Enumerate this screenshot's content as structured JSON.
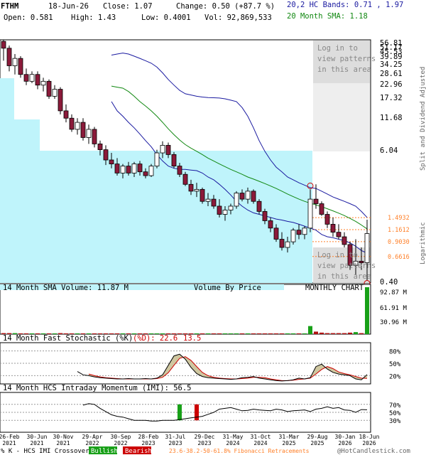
{
  "header": {
    "ticker": "FTHM",
    "date": "18-Jun-26",
    "close_label": "Close: 1.07",
    "change_label": "Change: 0.50 (+87.7 %)",
    "open_label": "Open: 0.581",
    "high_label": "High: 1.43",
    "low_label": "Low: 0.4001",
    "vol_label": "Vol: 92,869,533",
    "bands_label": "20,2 HC Bands: 0.71 , 1.97",
    "sma_label": "20 Month SMA: 1.18"
  },
  "overlay_text": {
    "login_top": [
      "Log in to",
      "view patterns",
      "in this area"
    ],
    "login_bottom": [
      "Log in to",
      "view patterns",
      "in this area"
    ]
  },
  "vertical_labels": {
    "adjusted": "Split and Dividend Adjusted",
    "scale": "Logarithmic"
  },
  "panel_titles": {
    "volume": "14 Month SMA Volume: 11.87 M",
    "volume_by_price": "Volume By Price",
    "monthly": "MONTHLY CHART",
    "stoch_main": "14 Month Fast Stochastic (%K)",
    "stoch_d": "(%D): 22.6",
    "stoch_d_val": "13.5",
    "imi": "14 Month HCS Intraday Momentum (IMI): 56.5"
  },
  "footer": {
    "prefix": "% K - HCS IMI Crossover:",
    "bullish": "Bullish",
    "bearish": "Bearish",
    "fib": "23.6-38.2-50-61.8% Fibonacci Retracements",
    "copyright": "@HotCandlestick.com"
  },
  "colors": {
    "bull": "#ffffff",
    "bear": "#8b1a3a",
    "hc_band": "#1a1aa0",
    "sma": "#118811",
    "vol_bar_bull": "#18a018",
    "vol_bar_bear": "#b01010",
    "cyan": "#bff4fb",
    "gray": "#dddddd",
    "fib": "#ff7f27",
    "stoch_fill": "#cfc7a0",
    "stoch_k": "#000000",
    "stoch_d": "#cc0000"
  },
  "chart_data": {
    "type": "candlestick",
    "scale": "log",
    "price_axis_labels": [
      "56.81",
      "51.17",
      "45.53",
      "39.89",
      "34.25",
      "28.61",
      "22.96",
      "17.32",
      "11.68",
      "6.04",
      "0.40"
    ],
    "fib_levels": [
      "1.4932",
      "1.1612",
      "0.9030",
      "0.6616"
    ],
    "x_tick_labels": [
      "26-Feb\n2021",
      "30-Jun\n2021",
      "30-Nov\n2021",
      "29-Apr\n2022",
      "30-Sep\n2022",
      "28-Feb\n2023",
      "31-Jul\n2023",
      "29-Dec\n2023",
      "31-May\n2024",
      "31-Oct\n2024",
      "31-Mar\n2025",
      "29-Aug\n2025",
      "30-Jan\n2026",
      "18-Jun\n2026"
    ],
    "volume_axis_labels": [
      "92.87 M",
      "61.91 M",
      "30.96 M"
    ],
    "stoch_axis_labels": [
      "80%",
      "50%",
      "20%"
    ],
    "imi_axis_labels": [
      "70%",
      "50%",
      "30%"
    ],
    "candles": [
      {
        "o": 60,
        "h": 62,
        "l": 40,
        "c": 52
      },
      {
        "o": 52,
        "h": 55,
        "l": 32,
        "c": 36
      },
      {
        "o": 36,
        "h": 46,
        "l": 30,
        "c": 42
      },
      {
        "o": 42,
        "h": 44,
        "l": 28,
        "c": 30
      },
      {
        "o": 30,
        "h": 34,
        "l": 24,
        "c": 26
      },
      {
        "o": 26,
        "h": 32,
        "l": 25,
        "c": 30
      },
      {
        "o": 30,
        "h": 32,
        "l": 22,
        "c": 24
      },
      {
        "o": 24,
        "h": 28,
        "l": 21,
        "c": 26
      },
      {
        "o": 26,
        "h": 27,
        "l": 18,
        "c": 19
      },
      {
        "o": 19,
        "h": 24,
        "l": 18,
        "c": 22
      },
      {
        "o": 22,
        "h": 23,
        "l": 13,
        "c": 14
      },
      {
        "o": 14,
        "h": 16,
        "l": 11,
        "c": 12
      },
      {
        "o": 12,
        "h": 13,
        "l": 9,
        "c": 9.5
      },
      {
        "o": 9.5,
        "h": 12,
        "l": 8.5,
        "c": 11
      },
      {
        "o": 11,
        "h": 12,
        "l": 7.5,
        "c": 8
      },
      {
        "o": 8,
        "h": 10.5,
        "l": 7,
        "c": 9.5
      },
      {
        "o": 9.5,
        "h": 10,
        "l": 6.5,
        "c": 7
      },
      {
        "o": 7,
        "h": 7.5,
        "l": 5.5,
        "c": 6.2
      },
      {
        "o": 6.2,
        "h": 6.8,
        "l": 4.5,
        "c": 5
      },
      {
        "o": 5,
        "h": 5.8,
        "l": 4.2,
        "c": 4.6
      },
      {
        "o": 4.6,
        "h": 5.2,
        "l": 3.6,
        "c": 3.8
      },
      {
        "o": 3.8,
        "h": 4.6,
        "l": 3.4,
        "c": 4.4
      },
      {
        "o": 4.4,
        "h": 4.8,
        "l": 3.6,
        "c": 3.8
      },
      {
        "o": 3.8,
        "h": 4.8,
        "l": 3.5,
        "c": 4.6
      },
      {
        "o": 4.6,
        "h": 4.9,
        "l": 3.6,
        "c": 3.9
      },
      {
        "o": 3.9,
        "h": 4.2,
        "l": 3.4,
        "c": 3.6
      },
      {
        "o": 3.6,
        "h": 4.6,
        "l": 3.5,
        "c": 4.4
      },
      {
        "o": 4.4,
        "h": 6.2,
        "l": 4.2,
        "c": 5.8
      },
      {
        "o": 5.8,
        "h": 7.4,
        "l": 5.2,
        "c": 6.8
      },
      {
        "o": 6.8,
        "h": 7.2,
        "l": 5.2,
        "c": 5.6
      },
      {
        "o": 5.6,
        "h": 5.9,
        "l": 4.2,
        "c": 4.4
      },
      {
        "o": 4.4,
        "h": 4.7,
        "l": 3.5,
        "c": 3.7
      },
      {
        "o": 3.7,
        "h": 3.9,
        "l": 2.9,
        "c": 3.0
      },
      {
        "o": 3.0,
        "h": 3.3,
        "l": 2.4,
        "c": 2.6
      },
      {
        "o": 2.6,
        "h": 3.1,
        "l": 2.3,
        "c": 2.7
      },
      {
        "o": 2.7,
        "h": 2.8,
        "l": 2.0,
        "c": 2.1
      },
      {
        "o": 2.1,
        "h": 2.5,
        "l": 1.9,
        "c": 2.2
      },
      {
        "o": 2.2,
        "h": 2.4,
        "l": 1.8,
        "c": 1.9
      },
      {
        "o": 1.9,
        "h": 2.2,
        "l": 1.5,
        "c": 1.6
      },
      {
        "o": 1.6,
        "h": 1.9,
        "l": 1.4,
        "c": 1.75
      },
      {
        "o": 1.75,
        "h": 2.0,
        "l": 1.6,
        "c": 1.9
      },
      {
        "o": 1.9,
        "h": 2.6,
        "l": 1.8,
        "c": 2.5
      },
      {
        "o": 2.5,
        "h": 2.7,
        "l": 2.1,
        "c": 2.2
      },
      {
        "o": 2.2,
        "h": 2.8,
        "l": 2.0,
        "c": 2.6
      },
      {
        "o": 2.6,
        "h": 2.7,
        "l": 2.0,
        "c": 2.1
      },
      {
        "o": 2.1,
        "h": 2.2,
        "l": 1.6,
        "c": 1.7
      },
      {
        "o": 1.7,
        "h": 1.8,
        "l": 1.3,
        "c": 1.4
      },
      {
        "o": 1.4,
        "h": 1.5,
        "l": 1.1,
        "c": 1.2
      },
      {
        "o": 1.2,
        "h": 1.3,
        "l": 0.9,
        "c": 0.95
      },
      {
        "o": 0.95,
        "h": 1.1,
        "l": 0.75,
        "c": 0.8
      },
      {
        "o": 0.8,
        "h": 1.0,
        "l": 0.72,
        "c": 0.9
      },
      {
        "o": 0.9,
        "h": 1.2,
        "l": 0.85,
        "c": 1.15
      },
      {
        "o": 1.15,
        "h": 1.3,
        "l": 0.95,
        "c": 1.05
      },
      {
        "o": 1.05,
        "h": 1.25,
        "l": 0.95,
        "c": 1.2
      },
      {
        "o": 1.2,
        "h": 2.7,
        "l": 1.1,
        "c": 2.2
      },
      {
        "o": 2.2,
        "h": 3.0,
        "l": 1.8,
        "c": 2.0
      },
      {
        "o": 2.0,
        "h": 2.1,
        "l": 1.55,
        "c": 1.6
      },
      {
        "o": 1.6,
        "h": 1.7,
        "l": 1.2,
        "c": 1.3
      },
      {
        "o": 1.3,
        "h": 1.5,
        "l": 1.0,
        "c": 1.1
      },
      {
        "o": 1.1,
        "h": 1.3,
        "l": 0.95,
        "c": 1.0
      },
      {
        "o": 1.0,
        "h": 1.1,
        "l": 0.8,
        "c": 0.85
      },
      {
        "o": 0.85,
        "h": 0.9,
        "l": 0.5,
        "c": 0.55
      },
      {
        "o": 0.55,
        "h": 0.95,
        "l": 0.45,
        "c": 0.6
      },
      {
        "o": 0.6,
        "h": 0.8,
        "l": 0.5,
        "c": 0.58
      },
      {
        "o": 0.581,
        "h": 1.43,
        "l": 0.4001,
        "c": 1.07
      }
    ],
    "hc_upper": [
      null,
      null,
      null,
      null,
      null,
      null,
      null,
      null,
      null,
      null,
      null,
      null,
      null,
      null,
      null,
      null,
      null,
      null,
      null,
      45,
      46,
      47,
      46,
      44,
      42,
      40,
      38,
      35,
      31,
      27,
      24,
      21.5,
      20,
      19.5,
      19,
      18.7,
      18.5,
      18.4,
      18.3,
      18,
      17.5,
      17,
      15,
      12.5,
      9.8,
      7.5,
      6,
      5.0,
      4.3,
      3.9,
      3.5,
      3.3,
      3.1,
      2.95,
      2.8,
      2.75,
      2.6,
      2.45,
      2.3,
      2.2,
      2.1,
      2.0,
      1.9,
      1.7,
      1.5
    ],
    "hc_lower": [
      null,
      null,
      null,
      null,
      null,
      null,
      null,
      null,
      null,
      null,
      null,
      null,
      null,
      null,
      null,
      null,
      null,
      null,
      null,
      17,
      14,
      12.5,
      11,
      9.8,
      8.6,
      7.5,
      6.6,
      5.6,
      4.9,
      4.4,
      4.2,
      4.1,
      4.1,
      4.05,
      4.0,
      3.8,
      3.5,
      3.3,
      3.0,
      2.7,
      2.4,
      2.1,
      1.9,
      1.75,
      1.65,
      1.6,
      1.55,
      1.5,
      1.45,
      1.42,
      1.38,
      1.35,
      1.3,
      1.25,
      1.2,
      1.15,
      1.05,
      1.0,
      0.98,
      0.95,
      0.92,
      0.88,
      0.82,
      0.75,
      0.71
    ],
    "sma20": [
      null,
      null,
      null,
      null,
      null,
      null,
      null,
      null,
      null,
      null,
      null,
      null,
      null,
      null,
      null,
      null,
      null,
      null,
      null,
      23.5,
      23,
      22.5,
      21,
      19,
      17,
      15.5,
      14,
      12.5,
      11,
      9.6,
      8.5,
      7.6,
      6.9,
      6.4,
      6.0,
      5.6,
      5.2,
      4.9,
      4.6,
      4.35,
      4.1,
      3.9,
      3.7,
      3.5,
      3.35,
      3.2,
      3.05,
      2.9,
      2.75,
      2.6,
      2.45,
      2.32,
      2.2,
      2.1,
      2.02,
      1.95,
      1.88,
      1.8,
      1.72,
      1.64,
      1.56,
      1.47,
      1.38,
      1.28,
      1.18
    ],
    "volume": [
      2,
      2,
      2,
      1.5,
      1.5,
      1.5,
      1.5,
      1.5,
      1.5,
      1.5,
      2,
      1.5,
      1.5,
      1.5,
      1.5,
      1.5,
      1.5,
      1.5,
      1.5,
      1.5,
      1.5,
      1.5,
      1.5,
      1.5,
      1.5,
      1.5,
      1.5,
      1.5,
      1.5,
      1.5,
      1.5,
      1.5,
      1.5,
      1.5,
      1.5,
      1.5,
      1.5,
      1.5,
      1.5,
      1.5,
      1.5,
      1.5,
      1.5,
      1.5,
      1.5,
      1.5,
      1.5,
      1.5,
      1.5,
      1.5,
      1.5,
      1.5,
      1.5,
      1.5,
      16,
      5,
      3,
      2,
      2,
      2,
      2,
      3,
      4,
      2,
      92.87
    ],
    "stoch_k": [
      null,
      null,
      null,
      null,
      null,
      null,
      null,
      null,
      null,
      null,
      null,
      null,
      null,
      30,
      22,
      20,
      17,
      15,
      14,
      13,
      12,
      12,
      13,
      12,
      12,
      13,
      12,
      14,
      22,
      45,
      68,
      72,
      60,
      40,
      25,
      18,
      15,
      14,
      13,
      12,
      11,
      12,
      15,
      16,
      18,
      14,
      12,
      10,
      8,
      7,
      8,
      10,
      14,
      12,
      15,
      42,
      48,
      36,
      28,
      24,
      22,
      20,
      12,
      10,
      22.6
    ],
    "stoch_d": [
      null,
      null,
      null,
      null,
      null,
      null,
      null,
      null,
      null,
      null,
      null,
      null,
      null,
      null,
      null,
      24,
      20,
      17,
      15,
      14,
      13,
      12,
      12,
      12,
      12,
      12,
      12,
      13,
      16,
      27,
      45,
      62,
      66,
      57,
      42,
      28,
      20,
      16,
      14,
      13,
      12,
      12,
      13,
      14,
      16,
      16,
      15,
      12,
      10,
      8,
      8,
      9,
      11,
      12,
      14,
      24,
      35,
      42,
      37,
      29,
      25,
      22,
      18,
      14,
      13.5
    ],
    "imi": [
      null,
      null,
      null,
      null,
      null,
      null,
      null,
      null,
      null,
      null,
      null,
      null,
      null,
      null,
      68,
      72,
      70,
      60,
      52,
      44,
      40,
      38,
      34,
      30,
      30,
      30,
      28,
      28,
      30,
      30,
      30,
      32,
      34,
      36,
      38,
      40,
      45,
      50,
      58,
      60,
      62,
      58,
      54,
      55,
      58,
      56,
      55,
      54,
      58,
      56,
      52,
      54,
      55,
      56,
      52,
      58,
      60,
      64,
      60,
      62,
      56,
      55,
      50,
      57,
      56.5
    ],
    "imi_markers": [
      {
        "index": 31,
        "type": "bullish"
      },
      {
        "index": 34,
        "type": "bearish"
      }
    ]
  }
}
